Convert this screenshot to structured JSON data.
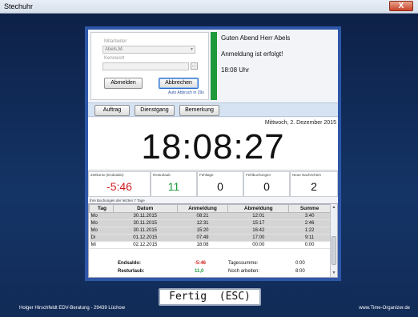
{
  "window": {
    "title": "Stechuhr",
    "close_label": "X"
  },
  "login": {
    "employee_label": "Mitarbeiter",
    "employee_value": "Abels,M.",
    "password_label": "Kennwort",
    "password_value": "",
    "logout_button": "Abmelden",
    "cancel_button": "Abbrechen",
    "auto_cancel": "Auto Abbruch in 29s"
  },
  "greeting": {
    "line1": "Guten Abend Herr Abels",
    "line2": "Anmeldung ist erfolgt!",
    "line3": "18:08 Uhr"
  },
  "toolbar": {
    "order": "Auftrag",
    "business_trip": "Dienstgang",
    "remark": "Bemerkung"
  },
  "clock": {
    "date": "Mittwoch, 2. Dezember 2015",
    "time": "18:08:27"
  },
  "stats": [
    {
      "label": "Zeitkonto (Endsaldo)",
      "value": "-5:46",
      "color": "#d01c1c"
    },
    {
      "label": "Resturlaub",
      "value": "11",
      "color": "#1e9a3a"
    },
    {
      "label": "Fehltage",
      "value": "0",
      "color": "#111111"
    },
    {
      "label": "Fehlbuchungen",
      "value": "0",
      "color": "#111111"
    },
    {
      "label": "Neue Nachrichten",
      "value": "2",
      "color": "#111111"
    }
  ],
  "bookings": {
    "caption": "Ihre Buchungen der letzten 7 Tage",
    "columns": [
      "Tag",
      "Datum",
      "Anmeldung",
      "Abmeldung",
      "Summe"
    ],
    "rows": [
      [
        "Mo",
        "30.11.2015",
        "08:21",
        "12:01",
        "3:40"
      ],
      [
        "Mo",
        "30.11.2015",
        "12:31",
        "15:17",
        "2:46"
      ],
      [
        "Mo",
        "30.11.2015",
        "15:20",
        "16:42",
        "1:22"
      ],
      [
        "Di",
        "01.12.2015",
        "07:49",
        "17:00",
        "9:11"
      ],
      [
        "Mi",
        "02.12.2015",
        "18:08",
        "00:00",
        "0:00"
      ]
    ],
    "summary": {
      "balance_label": "Endsaldo:",
      "balance_value": "-5:46",
      "vacation_label": "Resturlaub:",
      "vacation_value": "11,0",
      "daysum_label": "Tagessumme:",
      "daysum_value": "0:00",
      "remaining_label": "Noch arbeiten:",
      "remaining_value": "8:00"
    }
  },
  "done_button": "Fertig  (ESC)",
  "footer": {
    "left": "Holger Hirschfeldt EDV-Beratung - 29439 Lüchow",
    "right": "www.Time-Organizer.de"
  },
  "colors": {
    "accent": "#2e57a8",
    "ok": "#1e9a3a",
    "negative": "#d01c1c"
  }
}
